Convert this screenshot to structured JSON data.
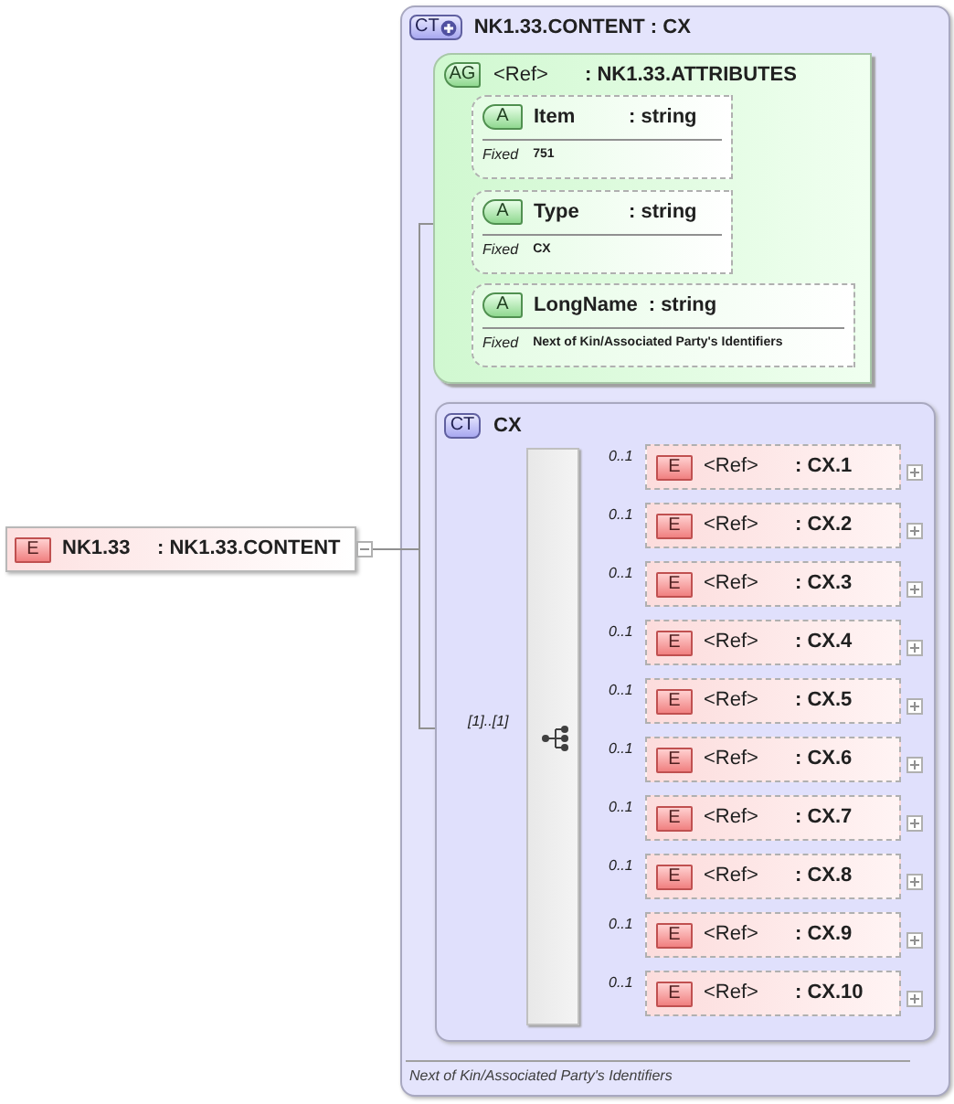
{
  "root_element": {
    "badge": "E",
    "name": "NK1.33",
    "type": ": NK1.33.CONTENT",
    "expanded": true
  },
  "complex_type": {
    "badge": "CT",
    "name": "NK1.33.CONTENT : CX",
    "attribute_group": {
      "badge": "AG",
      "ref": "<Ref>",
      "type": ": NK1.33.ATTRIBUTES",
      "attributes": [
        {
          "badge": "A",
          "name": "Item",
          "type": ": string",
          "fixed_label": "Fixed",
          "fixed_value": "751"
        },
        {
          "badge": "A",
          "name": "Type",
          "type": ": string",
          "fixed_label": "Fixed",
          "fixed_value": "CX"
        },
        {
          "badge": "A",
          "name": "LongName",
          "type": ": string",
          "fixed_label": "Fixed",
          "fixed_value": "Next of Kin/Associated Party's Identifiers"
        }
      ]
    },
    "content": {
      "badge": "CT",
      "name": "CX",
      "cardinality": "[1]..[1]",
      "children": [
        {
          "cardinality": "0..1",
          "badge": "E",
          "ref": "<Ref>",
          "type": ": CX.1",
          "expanded": false
        },
        {
          "cardinality": "0..1",
          "badge": "E",
          "ref": "<Ref>",
          "type": ": CX.2",
          "expanded": false
        },
        {
          "cardinality": "0..1",
          "badge": "E",
          "ref": "<Ref>",
          "type": ": CX.3",
          "expanded": false
        },
        {
          "cardinality": "0..1",
          "badge": "E",
          "ref": "<Ref>",
          "type": ": CX.4",
          "expanded": false
        },
        {
          "cardinality": "0..1",
          "badge": "E",
          "ref": "<Ref>",
          "type": ": CX.5",
          "expanded": false
        },
        {
          "cardinality": "0..1",
          "badge": "E",
          "ref": "<Ref>",
          "type": ": CX.6",
          "expanded": false
        },
        {
          "cardinality": "0..1",
          "badge": "E",
          "ref": "<Ref>",
          "type": ": CX.7",
          "expanded": false
        },
        {
          "cardinality": "0..1",
          "badge": "E",
          "ref": "<Ref>",
          "type": ": CX.8",
          "expanded": false
        },
        {
          "cardinality": "0..1",
          "badge": "E",
          "ref": "<Ref>",
          "type": ": CX.9",
          "expanded": false
        },
        {
          "cardinality": "0..1",
          "badge": "E",
          "ref": "<Ref>",
          "type": ": CX.10",
          "expanded": false
        }
      ]
    },
    "documentation": "Next of Kin/Associated Party's Identifiers"
  }
}
